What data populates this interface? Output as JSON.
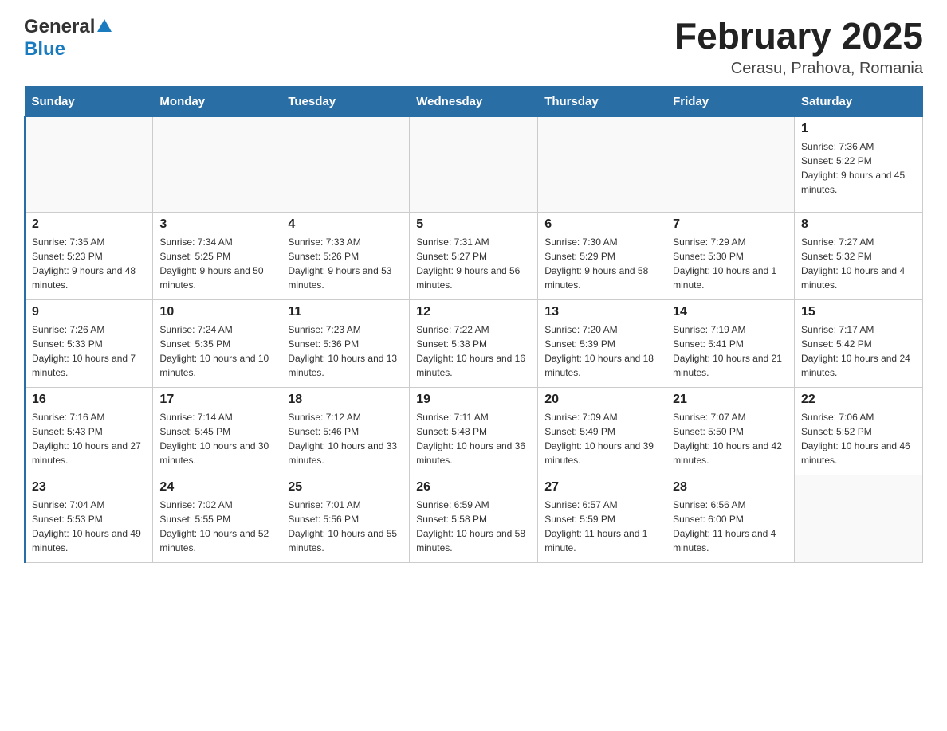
{
  "header": {
    "logo_general": "General",
    "logo_blue": "Blue",
    "month_title": "February 2025",
    "location": "Cerasu, Prahova, Romania"
  },
  "days_of_week": [
    "Sunday",
    "Monday",
    "Tuesday",
    "Wednesday",
    "Thursday",
    "Friday",
    "Saturday"
  ],
  "weeks": [
    [
      {
        "day": "",
        "info": ""
      },
      {
        "day": "",
        "info": ""
      },
      {
        "day": "",
        "info": ""
      },
      {
        "day": "",
        "info": ""
      },
      {
        "day": "",
        "info": ""
      },
      {
        "day": "",
        "info": ""
      },
      {
        "day": "1",
        "info": "Sunrise: 7:36 AM\nSunset: 5:22 PM\nDaylight: 9 hours and 45 minutes."
      }
    ],
    [
      {
        "day": "2",
        "info": "Sunrise: 7:35 AM\nSunset: 5:23 PM\nDaylight: 9 hours and 48 minutes."
      },
      {
        "day": "3",
        "info": "Sunrise: 7:34 AM\nSunset: 5:25 PM\nDaylight: 9 hours and 50 minutes."
      },
      {
        "day": "4",
        "info": "Sunrise: 7:33 AM\nSunset: 5:26 PM\nDaylight: 9 hours and 53 minutes."
      },
      {
        "day": "5",
        "info": "Sunrise: 7:31 AM\nSunset: 5:27 PM\nDaylight: 9 hours and 56 minutes."
      },
      {
        "day": "6",
        "info": "Sunrise: 7:30 AM\nSunset: 5:29 PM\nDaylight: 9 hours and 58 minutes."
      },
      {
        "day": "7",
        "info": "Sunrise: 7:29 AM\nSunset: 5:30 PM\nDaylight: 10 hours and 1 minute."
      },
      {
        "day": "8",
        "info": "Sunrise: 7:27 AM\nSunset: 5:32 PM\nDaylight: 10 hours and 4 minutes."
      }
    ],
    [
      {
        "day": "9",
        "info": "Sunrise: 7:26 AM\nSunset: 5:33 PM\nDaylight: 10 hours and 7 minutes."
      },
      {
        "day": "10",
        "info": "Sunrise: 7:24 AM\nSunset: 5:35 PM\nDaylight: 10 hours and 10 minutes."
      },
      {
        "day": "11",
        "info": "Sunrise: 7:23 AM\nSunset: 5:36 PM\nDaylight: 10 hours and 13 minutes."
      },
      {
        "day": "12",
        "info": "Sunrise: 7:22 AM\nSunset: 5:38 PM\nDaylight: 10 hours and 16 minutes."
      },
      {
        "day": "13",
        "info": "Sunrise: 7:20 AM\nSunset: 5:39 PM\nDaylight: 10 hours and 18 minutes."
      },
      {
        "day": "14",
        "info": "Sunrise: 7:19 AM\nSunset: 5:41 PM\nDaylight: 10 hours and 21 minutes."
      },
      {
        "day": "15",
        "info": "Sunrise: 7:17 AM\nSunset: 5:42 PM\nDaylight: 10 hours and 24 minutes."
      }
    ],
    [
      {
        "day": "16",
        "info": "Sunrise: 7:16 AM\nSunset: 5:43 PM\nDaylight: 10 hours and 27 minutes."
      },
      {
        "day": "17",
        "info": "Sunrise: 7:14 AM\nSunset: 5:45 PM\nDaylight: 10 hours and 30 minutes."
      },
      {
        "day": "18",
        "info": "Sunrise: 7:12 AM\nSunset: 5:46 PM\nDaylight: 10 hours and 33 minutes."
      },
      {
        "day": "19",
        "info": "Sunrise: 7:11 AM\nSunset: 5:48 PM\nDaylight: 10 hours and 36 minutes."
      },
      {
        "day": "20",
        "info": "Sunrise: 7:09 AM\nSunset: 5:49 PM\nDaylight: 10 hours and 39 minutes."
      },
      {
        "day": "21",
        "info": "Sunrise: 7:07 AM\nSunset: 5:50 PM\nDaylight: 10 hours and 42 minutes."
      },
      {
        "day": "22",
        "info": "Sunrise: 7:06 AM\nSunset: 5:52 PM\nDaylight: 10 hours and 46 minutes."
      }
    ],
    [
      {
        "day": "23",
        "info": "Sunrise: 7:04 AM\nSunset: 5:53 PM\nDaylight: 10 hours and 49 minutes."
      },
      {
        "day": "24",
        "info": "Sunrise: 7:02 AM\nSunset: 5:55 PM\nDaylight: 10 hours and 52 minutes."
      },
      {
        "day": "25",
        "info": "Sunrise: 7:01 AM\nSunset: 5:56 PM\nDaylight: 10 hours and 55 minutes."
      },
      {
        "day": "26",
        "info": "Sunrise: 6:59 AM\nSunset: 5:58 PM\nDaylight: 10 hours and 58 minutes."
      },
      {
        "day": "27",
        "info": "Sunrise: 6:57 AM\nSunset: 5:59 PM\nDaylight: 11 hours and 1 minute."
      },
      {
        "day": "28",
        "info": "Sunrise: 6:56 AM\nSunset: 6:00 PM\nDaylight: 11 hours and 4 minutes."
      },
      {
        "day": "",
        "info": ""
      }
    ]
  ]
}
